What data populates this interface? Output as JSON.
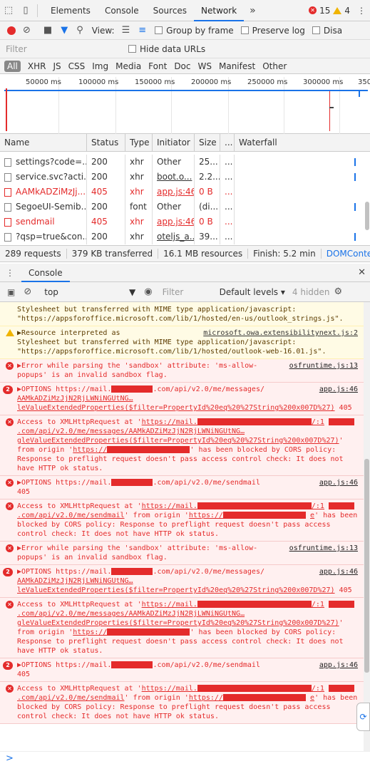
{
  "tabbar": {
    "tabs": [
      "Elements",
      "Console",
      "Sources",
      "Network"
    ],
    "active": "Network",
    "more": "»",
    "error_count": "15",
    "warning_count": "4",
    "menu": "⋮"
  },
  "network_toolbar": {
    "view_label": "View:",
    "group_by_frame": "Group by frame",
    "preserve_log": "Preserve log",
    "disable_cache": "Disa"
  },
  "filter": {
    "placeholder": "Filter",
    "hide_data_urls": "Hide data URLs"
  },
  "types": [
    "All",
    "XHR",
    "JS",
    "CSS",
    "Img",
    "Media",
    "Font",
    "Doc",
    "WS",
    "Manifest",
    "Other"
  ],
  "overview": {
    "ticks": [
      "50000 ms",
      "100000 ms",
      "150000 ms",
      "200000 ms",
      "250000 ms",
      "300000 ms",
      "350"
    ]
  },
  "table": {
    "headers": {
      "name": "Name",
      "status": "Status",
      "type": "Type",
      "initiator": "Initiator",
      "size": "Size",
      "dots": "...",
      "waterfall": "Waterfall"
    },
    "rows": [
      {
        "name": "settings?code=...",
        "status": "200",
        "type": "xhr",
        "initiator": "Other",
        "size": "25...",
        "dots": "...",
        "error": false,
        "link": false
      },
      {
        "name": "service.svc?acti...",
        "status": "200",
        "type": "xhr",
        "initiator": "boot.o...",
        "size": "2.2...",
        "dots": "...",
        "error": false,
        "link": true
      },
      {
        "name": "AAMkADZiMzJj...",
        "status": "405",
        "type": "xhr",
        "initiator": "app.js:46",
        "size": "0 B",
        "dots": "...",
        "error": true,
        "link": true
      },
      {
        "name": "SegoeUI-Semib...",
        "status": "200",
        "type": "font",
        "initiator": "Other",
        "size": "(di...",
        "dots": "...",
        "error": false,
        "link": false
      },
      {
        "name": "sendmail",
        "status": "405",
        "type": "xhr",
        "initiator": "app.js:46",
        "size": "0 B",
        "dots": "...",
        "error": true,
        "link": true
      },
      {
        "name": "?qsp=true&con...",
        "status": "200",
        "type": "xhr",
        "initiator": "oteljs_a...",
        "size": "39...",
        "dots": "...",
        "error": false,
        "link": true
      }
    ]
  },
  "summary": {
    "requests": "289 requests",
    "transferred": "379 KB transferred",
    "resources": "16.1 MB resources",
    "finish": "Finish: 5.2 min",
    "dcl": "DOMContentLoad"
  },
  "drawer": {
    "tab": "Console",
    "close": "✕"
  },
  "console_toolbar": {
    "context": "top",
    "filter_placeholder": "Filter",
    "levels": "Default levels ▾",
    "hidden": "4 hidden"
  },
  "messages": {
    "m0": {
      "text": "Stylesheet but transferred with MIME type application/javascript: \"https://appsforoffice.microsoft.com/lib/1/hosted/en-us/outlook_strings.js\"."
    },
    "m1": {
      "prefix": "▶Resource interpreted as",
      "src": "microsoft.owa.extensibilitynext.js:2",
      "text": "Stylesheet but transferred with MIME type application/javascript: \"https://appsforoffice.microsoft.com/lib/1/hosted/outlook-web-16.01.js\"."
    },
    "m2": {
      "src": "osfruntime.js:13",
      "text": "▶Error while parsing the 'sandbox' attribute: 'ms-allow-popups' is an invalid sandbox flag."
    },
    "m3": {
      "count": "2",
      "src": "app.js:46",
      "a": "▶OPTIONS https://mail.",
      "b": ".com/api/v2.0/me/messages/",
      "c": "AAMkADZiMzJjN2RjLWNiNGUtNG…leValueExtendedProperties($filter=PropertyId%20eq%20%27String%200x007D%27)",
      "d": " 405"
    },
    "m4": {
      "a": "Access to XMLHttpRequest at '",
      "b": "https://mail.",
      "c": "/:1",
      "d": ".com/api/v2.0/me/messages/AAMkADZiMzJjN2RjLWNiNGUtNG…gleValueExtendedProperties($filter=PropertyId%20eq%20%27String%200x007D%27)",
      "e": "' from origin '",
      "f": "https://",
      "g": "' has been blocked by CORS policy: Response to preflight request doesn't pass access control check: It does not have HTTP ok status."
    },
    "m5": {
      "src": "app.js:46",
      "a": "▶OPTIONS https://mail.",
      "b": ".com/api/v2.0/me/sendmail",
      "d": "405"
    },
    "m6": {
      "a": "Access to XMLHttpRequest at '",
      "b": "https://mail.",
      "c": "/:1",
      "d": ".com/api/v2.0/me/sendmail",
      "e": "' from origin '",
      "f": "https://",
      "g": "e",
      "h": "' has been blocked by CORS policy: Response to preflight request doesn't pass access control check: It does not have HTTP ok status."
    },
    "m7": {
      "src": "osfruntime.js:13",
      "text": "▶Error while parsing the 'sandbox' attribute: 'ms-allow-popups' is an invalid sandbox flag."
    },
    "m8": {
      "count": "2",
      "src": "app.js:46",
      "a": "▶OPTIONS https://mail.",
      "b": ".com/api/v2.0/me/messages/",
      "c": "AAMkADZiMzJjN2RjLWNiNGUtNG…leValueExtendedProperties($filter=PropertyId%20eq%20%27String%200x007D%27)",
      "d": " 405"
    },
    "m9": {
      "a": "Access to XMLHttpRequest at '",
      "b": "https://mail.",
      "c": "/:1",
      "d": ".com/api/v2.0/me/messages/AAMkADZiMzJjN2RjLWNiNGUtNG…gleValueExtendedProperties($filter=PropertyId%20eq%20%27String%200x007D%27)",
      "e": "' from origin '",
      "f": "https://",
      "g": "' has been blocked by CORS policy: Response to preflight request doesn't pass access control check: It does not have HTTP ok status."
    },
    "m10": {
      "count": "2",
      "src": "app.js:46",
      "a": "▶OPTIONS https://mail.",
      "b": ".com/api/v2.0/me/sendmail",
      "d": "405"
    },
    "m11": {
      "a": "Access to XMLHttpRequest at '",
      "b": "https://mail.",
      "c": "/:1",
      "d": ".com/api/v2.0/me/sendmail",
      "e": "' from origin '",
      "f": "https://",
      "g": "e",
      "h": "' has been blocked by CORS policy: Response to preflight request doesn't pass access control check: It does not have HTTP ok status."
    }
  },
  "prompt": {
    "glyph": ">"
  },
  "colors": {
    "error": "#e42b2b",
    "accent": "#1a73e8",
    "warning": "#f0b400"
  }
}
